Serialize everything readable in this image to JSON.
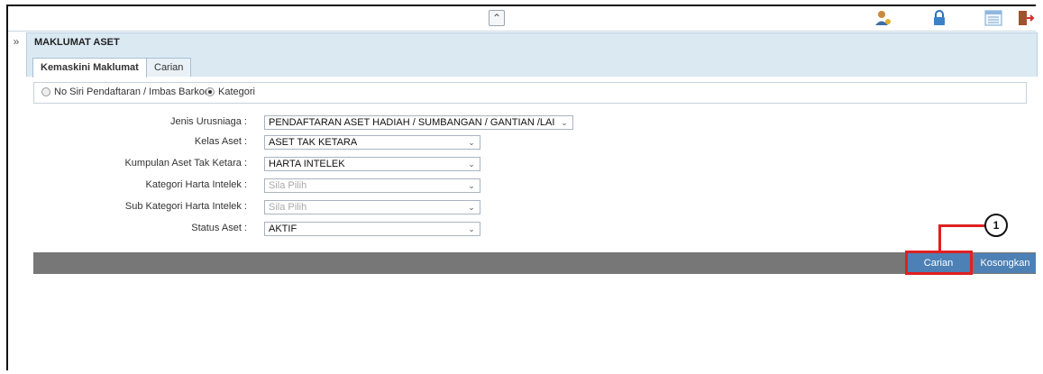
{
  "topbar": {
    "collapse_icon": "double-chevron-up-icon",
    "icons": [
      "user-profile-icon",
      "lock-icon",
      "calendar-list-icon",
      "logout-icon"
    ]
  },
  "panel": {
    "title": "MAKLUMAT ASET",
    "tabs": [
      {
        "label": "Kemaskini Maklumat",
        "active": true
      },
      {
        "label": "Carian",
        "active": false
      }
    ]
  },
  "search_mode": {
    "options": [
      {
        "label": "No Siri Pendaftaran / Imbas Barkod",
        "checked": false
      },
      {
        "label": "Kategori",
        "checked": true
      }
    ]
  },
  "form": {
    "fields": [
      {
        "label": "Jenis Urusniaga :",
        "value": "PENDAFTARAN ASET HADIAH / SUMBANGAN / GANTIAN /LAIN-LA",
        "placeholder": false
      },
      {
        "label": "Kelas Aset :",
        "value": "ASET TAK KETARA",
        "placeholder": false
      },
      {
        "label": "Kumpulan Aset Tak Ketara :",
        "value": "HARTA INTELEK",
        "placeholder": false
      },
      {
        "label": "Kategori Harta Intelek :",
        "value": "Sila Pilih",
        "placeholder": true
      },
      {
        "label": "Sub Kategori Harta Intelek :",
        "value": "Sila Pilih",
        "placeholder": true
      },
      {
        "label": "Status Aset :",
        "value": "AKTIF",
        "placeholder": false
      }
    ]
  },
  "actions": {
    "search_label": "Carian",
    "clear_label": "Kosongkan"
  },
  "annotation": {
    "step_number": "1"
  },
  "colors": {
    "header_bg": "#dbe9f3",
    "button_bg": "#4d80b4",
    "action_bar": "#777777",
    "highlight": "#e02020"
  }
}
